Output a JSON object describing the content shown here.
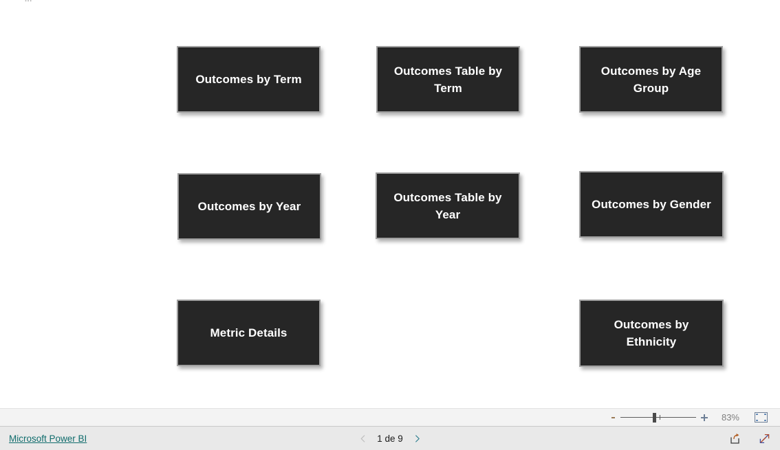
{
  "report": {
    "top_text_fragment": "...",
    "buttons": [
      {
        "id": "btn-outcomes-by-term",
        "label": "Outcomes by Term",
        "icon": "nav-button-icon"
      },
      {
        "id": "btn-outcomes-table-term",
        "label": "Outcomes Table by Term",
        "icon": "nav-button-icon"
      },
      {
        "id": "btn-outcomes-age-group",
        "label": "Outcomes by Age Group",
        "icon": "nav-button-icon"
      },
      {
        "id": "btn-outcomes-by-year",
        "label": "Outcomes by Year",
        "icon": "nav-button-icon"
      },
      {
        "id": "btn-outcomes-table-year",
        "label": "Outcomes Table by Year",
        "icon": "nav-button-icon"
      },
      {
        "id": "btn-outcomes-by-gender",
        "label": "Outcomes by Gender",
        "icon": "nav-button-icon"
      },
      {
        "id": "btn-metric-details",
        "label": "Metric Details",
        "icon": "nav-button-icon"
      },
      {
        "id": "btn-outcomes-by-ethnicity",
        "label": "Outcomes by Ethnicity",
        "icon": "nav-button-icon"
      }
    ],
    "button_colors": {
      "fill": "#262626",
      "border": "#a0a0a0",
      "text": "#ffffff"
    }
  },
  "zoom_toolbar": {
    "minus_icon": "minus-icon",
    "plus_icon": "plus-icon",
    "level": "83%",
    "fit_icon": "fit-to-page-icon"
  },
  "footer": {
    "brand_link": "Microsoft Power BI",
    "brand_link_color": "#0f6c6c",
    "prev_icon": "chevron-left-icon",
    "next_icon": "chevron-right-icon",
    "page_indicator": "1 de 9",
    "share_icon": "share-icon",
    "fullscreen_icon": "fullscreen-icon"
  }
}
